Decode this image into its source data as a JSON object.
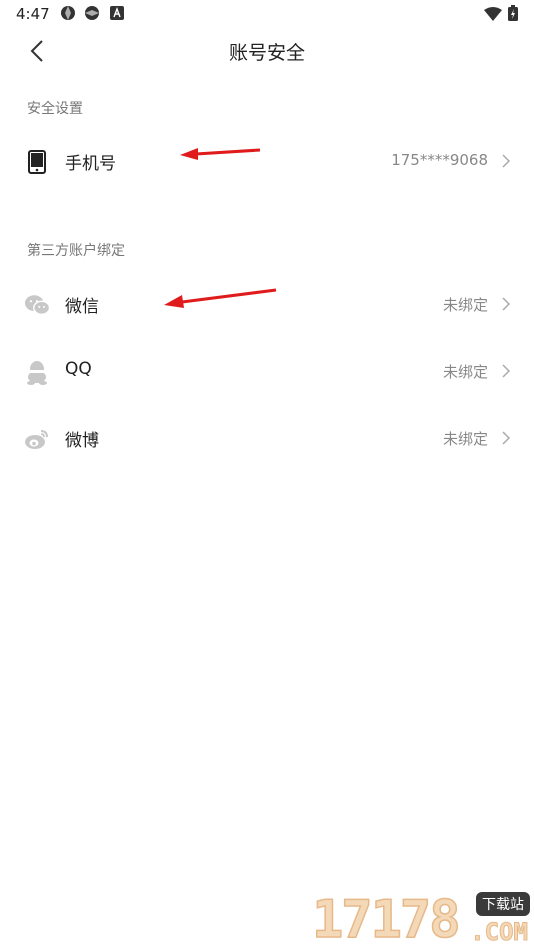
{
  "status_bar": {
    "time": "4:47",
    "icons": [
      "shutter-icon",
      "shutter-icon",
      "a-notification-icon",
      "wifi-icon",
      "battery-charging-icon"
    ]
  },
  "header": {
    "title": "账号安全",
    "back_icon": "chevron-left-icon"
  },
  "sections": {
    "security": {
      "label": "安全设置",
      "phone": {
        "label": "手机号",
        "value": "175****9068",
        "icon": "phone-icon"
      }
    },
    "third_party": {
      "label": "第三方账户绑定",
      "wechat": {
        "label": "微信",
        "value": "未绑定",
        "icon": "wechat-icon"
      },
      "qq": {
        "label": "QQ",
        "value": "未绑定",
        "icon": "qq-icon"
      },
      "weibo": {
        "label": "微博",
        "value": "未绑定",
        "icon": "weibo-icon"
      }
    }
  },
  "watermark": {
    "digits": "17178",
    "badge": "下载站",
    "domain": ".COM"
  },
  "colors": {
    "accent_arrow": "#e01b1b",
    "icon_gray": "#c8c8c8",
    "secondary_text": "#888888"
  }
}
